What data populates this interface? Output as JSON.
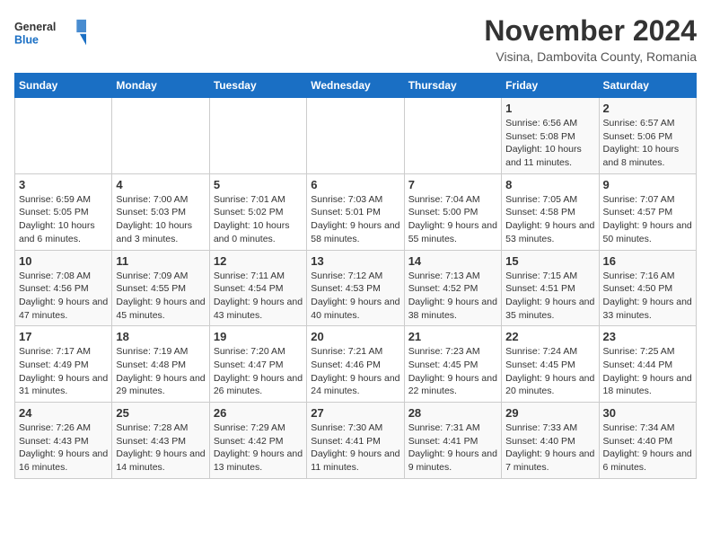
{
  "logo": {
    "line1": "General",
    "line2": "Blue"
  },
  "title": "November 2024",
  "subtitle": "Visina, Dambovita County, Romania",
  "days_of_week": [
    "Sunday",
    "Monday",
    "Tuesday",
    "Wednesday",
    "Thursday",
    "Friday",
    "Saturday"
  ],
  "weeks": [
    [
      {
        "day": "",
        "info": ""
      },
      {
        "day": "",
        "info": ""
      },
      {
        "day": "",
        "info": ""
      },
      {
        "day": "",
        "info": ""
      },
      {
        "day": "",
        "info": ""
      },
      {
        "day": "1",
        "info": "Sunrise: 6:56 AM\nSunset: 5:08 PM\nDaylight: 10 hours and 11 minutes."
      },
      {
        "day": "2",
        "info": "Sunrise: 6:57 AM\nSunset: 5:06 PM\nDaylight: 10 hours and 8 minutes."
      }
    ],
    [
      {
        "day": "3",
        "info": "Sunrise: 6:59 AM\nSunset: 5:05 PM\nDaylight: 10 hours and 6 minutes."
      },
      {
        "day": "4",
        "info": "Sunrise: 7:00 AM\nSunset: 5:03 PM\nDaylight: 10 hours and 3 minutes."
      },
      {
        "day": "5",
        "info": "Sunrise: 7:01 AM\nSunset: 5:02 PM\nDaylight: 10 hours and 0 minutes."
      },
      {
        "day": "6",
        "info": "Sunrise: 7:03 AM\nSunset: 5:01 PM\nDaylight: 9 hours and 58 minutes."
      },
      {
        "day": "7",
        "info": "Sunrise: 7:04 AM\nSunset: 5:00 PM\nDaylight: 9 hours and 55 minutes."
      },
      {
        "day": "8",
        "info": "Sunrise: 7:05 AM\nSunset: 4:58 PM\nDaylight: 9 hours and 53 minutes."
      },
      {
        "day": "9",
        "info": "Sunrise: 7:07 AM\nSunset: 4:57 PM\nDaylight: 9 hours and 50 minutes."
      }
    ],
    [
      {
        "day": "10",
        "info": "Sunrise: 7:08 AM\nSunset: 4:56 PM\nDaylight: 9 hours and 47 minutes."
      },
      {
        "day": "11",
        "info": "Sunrise: 7:09 AM\nSunset: 4:55 PM\nDaylight: 9 hours and 45 minutes."
      },
      {
        "day": "12",
        "info": "Sunrise: 7:11 AM\nSunset: 4:54 PM\nDaylight: 9 hours and 43 minutes."
      },
      {
        "day": "13",
        "info": "Sunrise: 7:12 AM\nSunset: 4:53 PM\nDaylight: 9 hours and 40 minutes."
      },
      {
        "day": "14",
        "info": "Sunrise: 7:13 AM\nSunset: 4:52 PM\nDaylight: 9 hours and 38 minutes."
      },
      {
        "day": "15",
        "info": "Sunrise: 7:15 AM\nSunset: 4:51 PM\nDaylight: 9 hours and 35 minutes."
      },
      {
        "day": "16",
        "info": "Sunrise: 7:16 AM\nSunset: 4:50 PM\nDaylight: 9 hours and 33 minutes."
      }
    ],
    [
      {
        "day": "17",
        "info": "Sunrise: 7:17 AM\nSunset: 4:49 PM\nDaylight: 9 hours and 31 minutes."
      },
      {
        "day": "18",
        "info": "Sunrise: 7:19 AM\nSunset: 4:48 PM\nDaylight: 9 hours and 29 minutes."
      },
      {
        "day": "19",
        "info": "Sunrise: 7:20 AM\nSunset: 4:47 PM\nDaylight: 9 hours and 26 minutes."
      },
      {
        "day": "20",
        "info": "Sunrise: 7:21 AM\nSunset: 4:46 PM\nDaylight: 9 hours and 24 minutes."
      },
      {
        "day": "21",
        "info": "Sunrise: 7:23 AM\nSunset: 4:45 PM\nDaylight: 9 hours and 22 minutes."
      },
      {
        "day": "22",
        "info": "Sunrise: 7:24 AM\nSunset: 4:45 PM\nDaylight: 9 hours and 20 minutes."
      },
      {
        "day": "23",
        "info": "Sunrise: 7:25 AM\nSunset: 4:44 PM\nDaylight: 9 hours and 18 minutes."
      }
    ],
    [
      {
        "day": "24",
        "info": "Sunrise: 7:26 AM\nSunset: 4:43 PM\nDaylight: 9 hours and 16 minutes."
      },
      {
        "day": "25",
        "info": "Sunrise: 7:28 AM\nSunset: 4:43 PM\nDaylight: 9 hours and 14 minutes."
      },
      {
        "day": "26",
        "info": "Sunrise: 7:29 AM\nSunset: 4:42 PM\nDaylight: 9 hours and 13 minutes."
      },
      {
        "day": "27",
        "info": "Sunrise: 7:30 AM\nSunset: 4:41 PM\nDaylight: 9 hours and 11 minutes."
      },
      {
        "day": "28",
        "info": "Sunrise: 7:31 AM\nSunset: 4:41 PM\nDaylight: 9 hours and 9 minutes."
      },
      {
        "day": "29",
        "info": "Sunrise: 7:33 AM\nSunset: 4:40 PM\nDaylight: 9 hours and 7 minutes."
      },
      {
        "day": "30",
        "info": "Sunrise: 7:34 AM\nSunset: 4:40 PM\nDaylight: 9 hours and 6 minutes."
      }
    ]
  ]
}
